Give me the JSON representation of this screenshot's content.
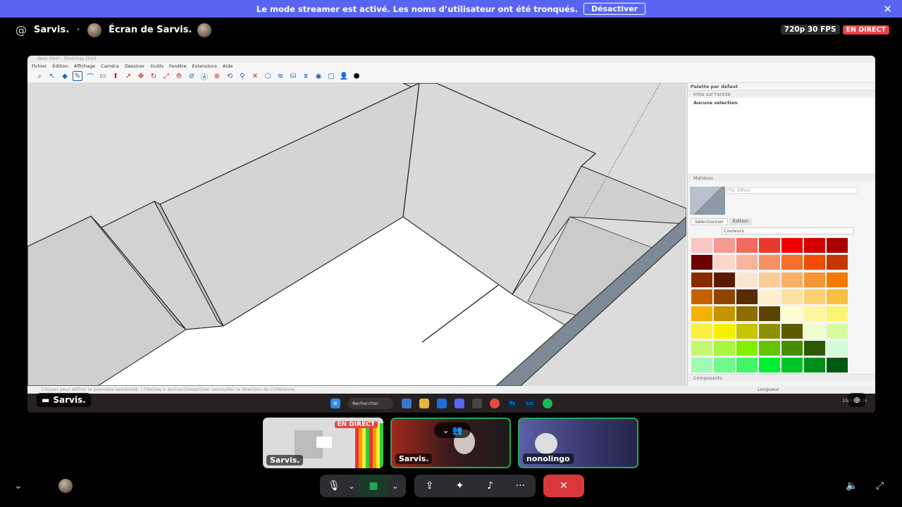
{
  "banner": {
    "message": "Le mode streamer est activé. Les noms d’utilisateur ont été tronqués.",
    "button": "Désactiver",
    "close": "✕"
  },
  "header": {
    "at": "@",
    "channel": "Sarvis.",
    "screen_title": "Écran de Sarvis.",
    "quality": "720p 30 FPS",
    "live": "EN DIRECT"
  },
  "sketchup": {
    "title": "Sans titre* - SketchUp 2024",
    "menu": [
      "Fichier",
      "Édition",
      "Affichage",
      "Caméra",
      "Dessiner",
      "Outils",
      "Fenêtre",
      "Extensions",
      "Aide"
    ],
    "panel": {
      "title": "Palette par défaut",
      "entity_section": "Infos sur l'entité",
      "no_selection": "Aucune sélection",
      "materials_section": "Matières",
      "material_name": "Par défaut",
      "tab_select": "Sélectionner",
      "tab_edit": "Édition",
      "colors_dropdown": "Couleurs",
      "components_section": "Composants"
    },
    "status": "Cliquez pour définir la première extrémité. | Flèches = Activer/Désactiver verrouiller la direction de l'inférence.",
    "length_label": "Longueur",
    "taskbar_search": "Rechercher",
    "tray_date": "15/01/2026"
  },
  "colors": {
    "swatches": [
      [
        "#f9c7c4",
        "#f49a93",
        "#f06a5e",
        "#ea3a2c",
        "#f50000",
        "#d30000",
        "#a80000"
      ],
      [
        "#6e0000",
        "#fcd6c9",
        "#f9b39b",
        "#f79163",
        "#f56e2a",
        "#f04d00",
        "#c43800"
      ],
      [
        "#8a2a00",
        "#5a1a00",
        "#fde6cf",
        "#fbcc98",
        "#f9b066",
        "#f79433",
        "#f57a00"
      ],
      [
        "#c76000",
        "#8f4500",
        "#5a2c00",
        "#fdf0d0",
        "#fde1a0",
        "#fbd070",
        "#f9bf40"
      ],
      [
        "#f5b000",
        "#c79400",
        "#8f6b00",
        "#5a4400",
        "#fefcd0",
        "#fdf8a0",
        "#fcf470"
      ],
      [
        "#f9f040",
        "#f5f000",
        "#c7c500",
        "#8f8f00",
        "#5a5a00",
        "#eefdd0",
        "#d9fba0"
      ],
      [
        "#c3f970",
        "#a8f540",
        "#80f000",
        "#62c500",
        "#478f00",
        "#2c5a00",
        "#d0fdd8"
      ],
      [
        "#a0fbb2",
        "#70f98c",
        "#40f566",
        "#00f030",
        "#00c527",
        "#008f1c",
        "#005a11"
      ]
    ]
  },
  "sharer": {
    "name": "Sarvis."
  },
  "tiles": [
    {
      "name": "Sarvis.",
      "live": "EN DIRECT"
    },
    {
      "name": "Sarvis."
    },
    {
      "name": "nonolingo"
    }
  ],
  "controls": {
    "more": "···"
  }
}
